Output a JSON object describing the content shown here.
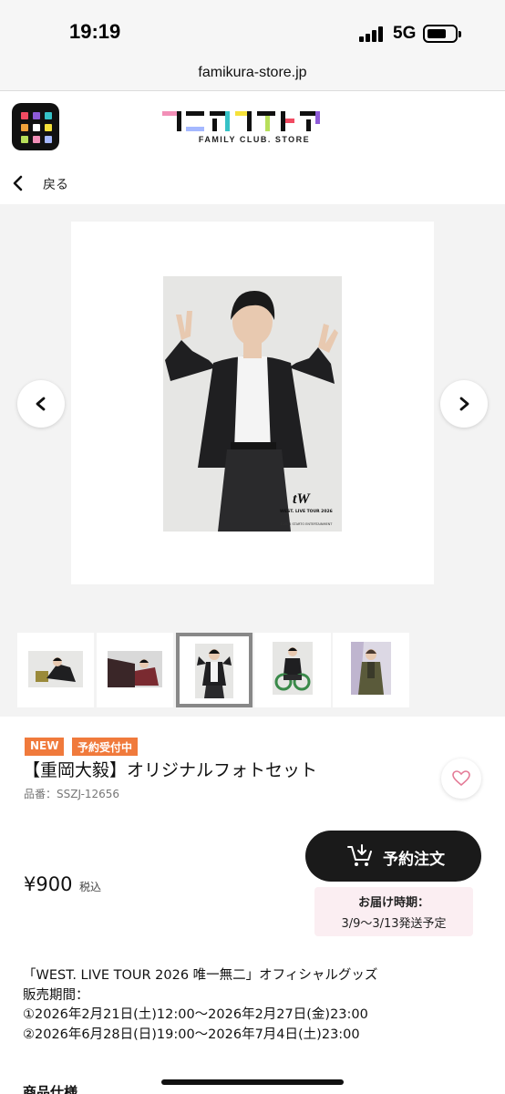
{
  "status": {
    "time": "19:19",
    "network": "5G",
    "battery_level": 0.65
  },
  "browser": {
    "url": "famikura-store.jp"
  },
  "header": {
    "logo_text": "ファミクラストア",
    "logo_subtitle": "FAMILY CLUB. STORE",
    "menu_colors": [
      "#f14b62",
      "#8e5bd8",
      "#36c2c7",
      "#f1a23a",
      "#ffffff",
      "#f5e13a",
      "#b7df5a",
      "#f28fb7",
      "#a5b8ff"
    ]
  },
  "nav": {
    "back_label": "戻る"
  },
  "gallery": {
    "thumbnails": [
      "thumb-1",
      "thumb-2",
      "thumb-3",
      "thumb-4",
      "thumb-5"
    ],
    "selected_index": 2
  },
  "product": {
    "badge_new": "NEW",
    "badge_preorder": "予約受付中",
    "title": "【重岡大毅】オリジナルフォトセット",
    "sku": "品番：SSZJ-12656",
    "price": "¥900",
    "tax": "税込",
    "order_button": "予約注文",
    "delivery_label": "お届け時期：",
    "delivery_date": "3/9〜3/13発送予定",
    "description_lines": [
      "「WEST. LIVE TOUR 2026 唯一無二」オフィシャルグッズ",
      "販売期間：",
      "①2026年2月21日(土)12:00〜2026年2月27日(金)23:00",
      "②2026年6月28日(日)19:00〜2026年7月4日(土)23:00"
    ],
    "specs_heading": "商品仕様"
  },
  "photo": {
    "logo_mark": "tW",
    "tour_text": "WEST. LIVE TOUR 2026",
    "copyright": "©2026 STARTO ENTERTAINMENT"
  },
  "colors": {
    "accent_badge": "#f07a3c",
    "button_dark": "#1a1a1a",
    "delivery_bg": "#fbeef2"
  }
}
